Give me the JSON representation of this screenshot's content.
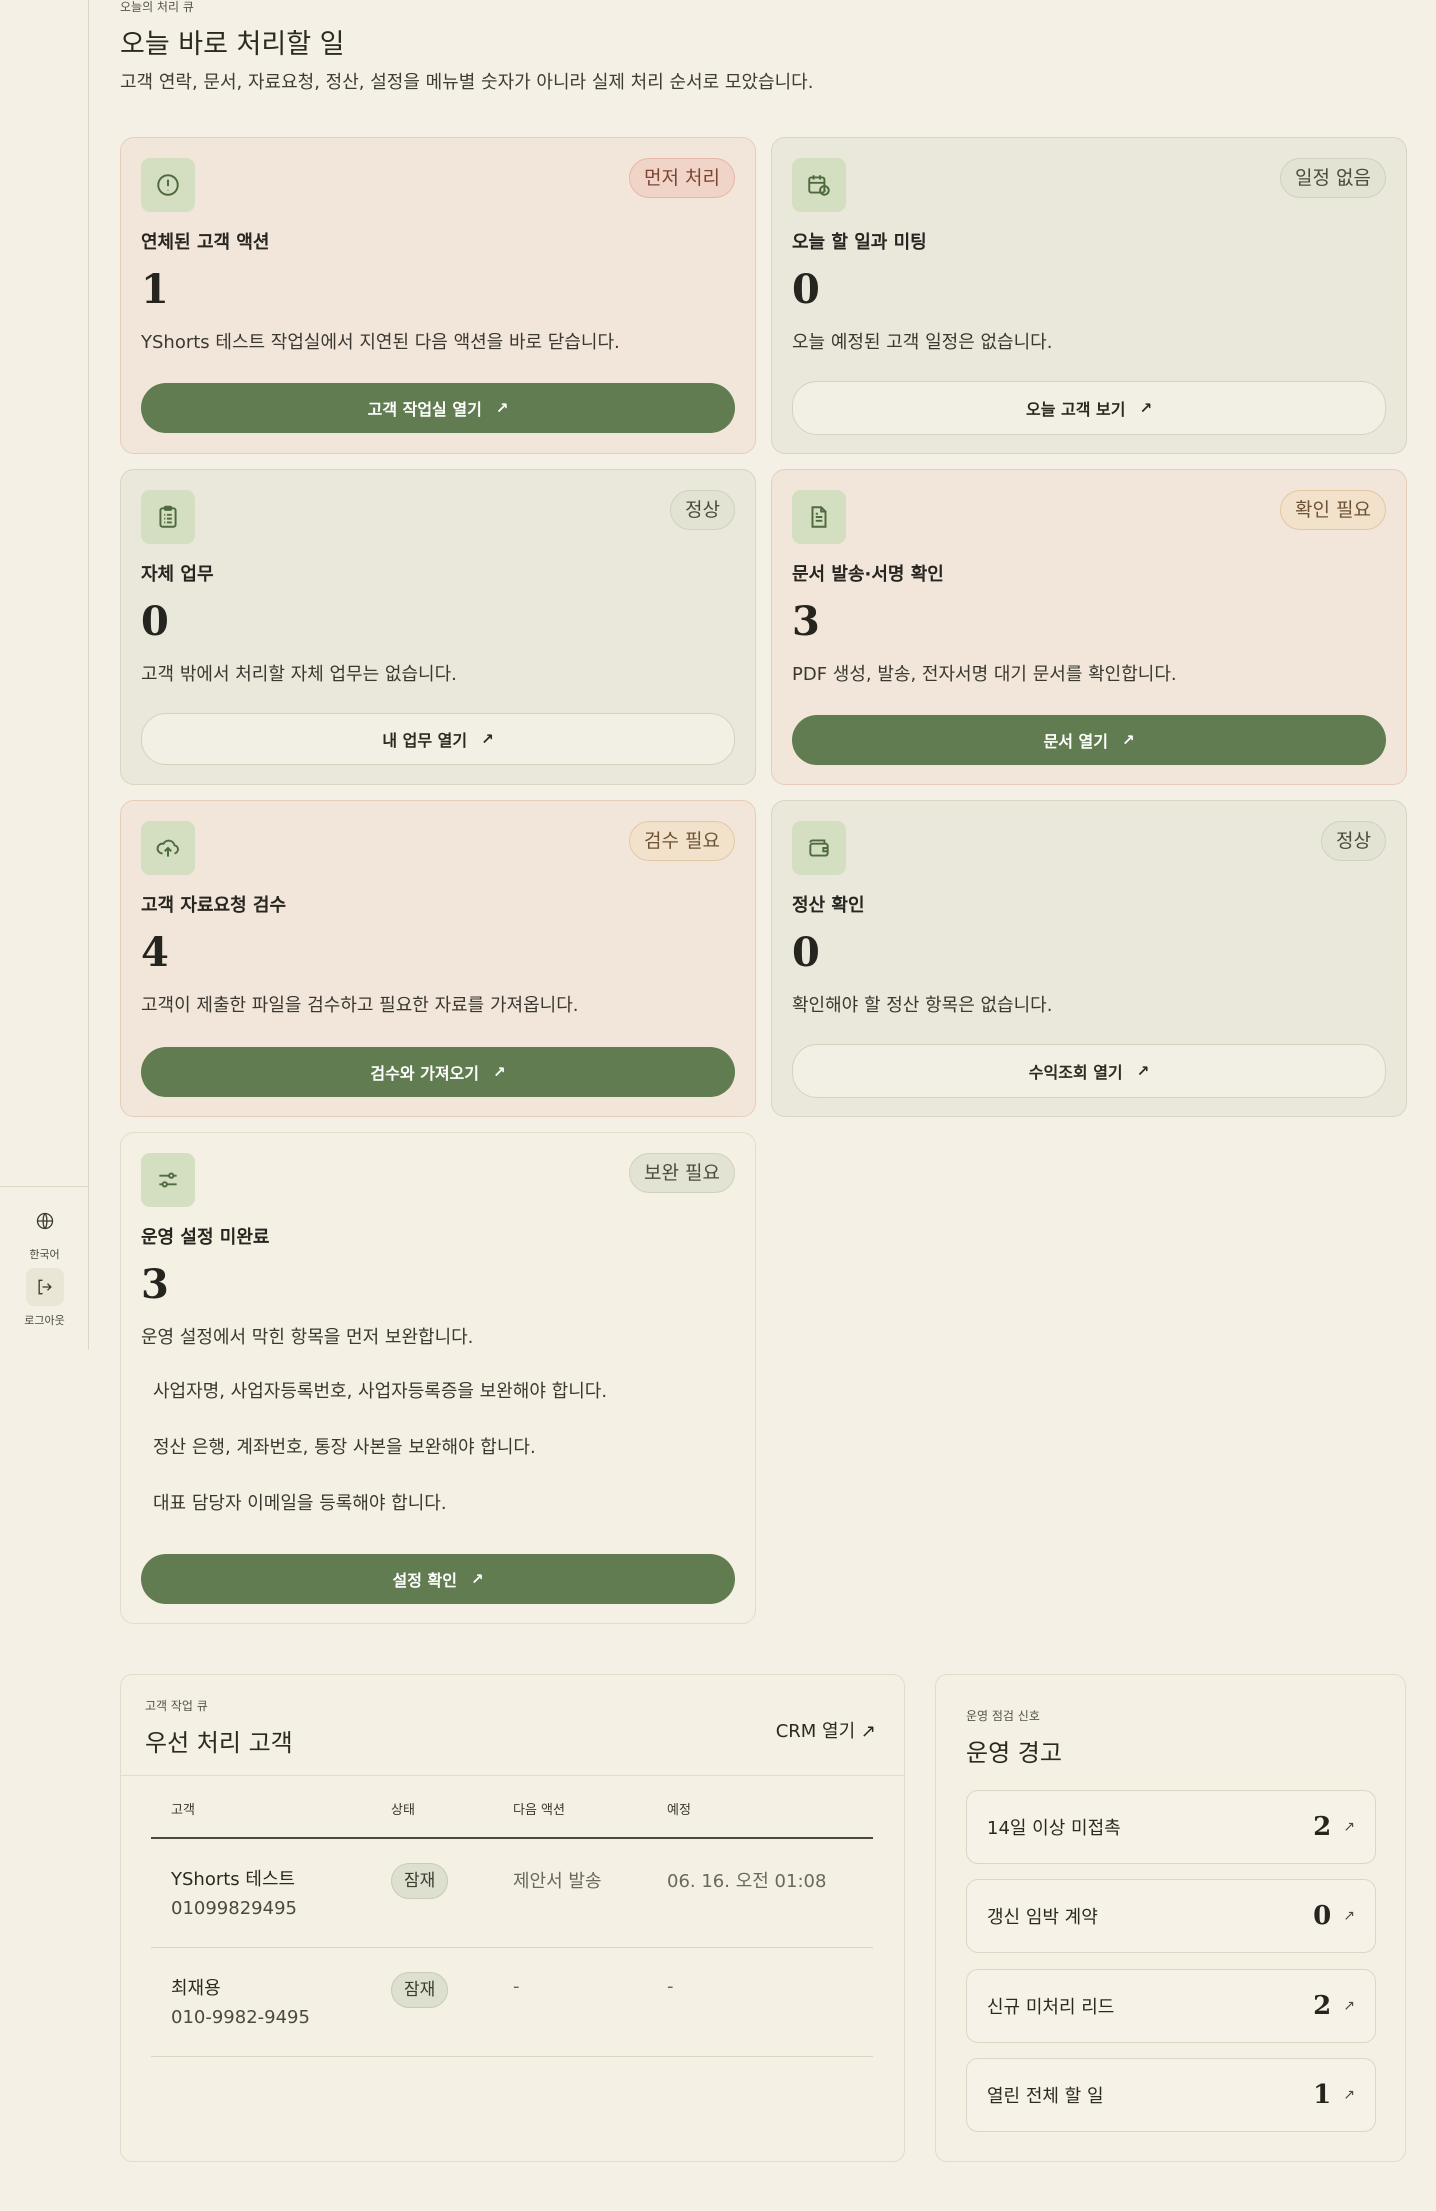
{
  "sidebar": {
    "language_label": "한국어",
    "logout_label": "로그아웃"
  },
  "header": {
    "eyebrow": "오늘의 처리 큐",
    "title": "오늘 바로 처리할 일",
    "subtitle": "고객 연락, 문서, 자료요청, 정산, 설정을 메뉴별 숫자가 아니라 실제 처리 순서로 모았습니다."
  },
  "cards": {
    "overdue": {
      "badge": "먼저 처리",
      "title": "연체된 고객 액션",
      "count": "1",
      "desc": "YShorts 테스트 작업실에서 지연된 다음 액션을 바로 닫습니다.",
      "button": "고객 작업실 열기",
      "icon": "alert-circle-icon"
    },
    "today": {
      "badge": "일정 없음",
      "title": "오늘 할 일과 미팅",
      "count": "0",
      "desc": "오늘 예정된 고객 일정은 없습니다.",
      "button": "오늘 고객 보기",
      "icon": "calendar-clock-icon"
    },
    "tasks": {
      "badge": "정상",
      "title": "자체 업무",
      "count": "0",
      "desc": "고객 밖에서 처리할 자체 업무는 없습니다.",
      "button": "내 업무 열기",
      "icon": "clipboard-list-icon"
    },
    "documents": {
      "badge": "확인 필요",
      "title": "문서 발송·서명 확인",
      "count": "3",
      "desc": "PDF 생성, 발송, 전자서명 대기 문서를 확인합니다.",
      "button": "문서 열기",
      "icon": "file-text-icon"
    },
    "requests": {
      "badge": "검수 필요",
      "title": "고객 자료요청 검수",
      "count": "4",
      "desc": "고객이 제출한 파일을 검수하고 필요한 자료를 가져옵니다.",
      "button": "검수와 가져오기",
      "icon": "cloud-upload-icon"
    },
    "settlement": {
      "badge": "정상",
      "title": "정산 확인",
      "count": "0",
      "desc": "확인해야 할 정산 항목은 없습니다.",
      "button": "수익조회 열기",
      "icon": "wallet-icon"
    },
    "settings": {
      "badge": "보완 필요",
      "title": "운영 설정 미완료",
      "count": "3",
      "desc": "운영 설정에서 막힌 항목을 먼저 보완합니다.",
      "issues": [
        "사업자명, 사업자등록번호, 사업자등록증을 보완해야 합니다.",
        "정산 은행, 계좌번호, 통장 사본을 보완해야 합니다.",
        "대표 담당자 이메일을 등록해야 합니다."
      ],
      "button": "설정 확인",
      "icon": "sliders-icon"
    }
  },
  "priority": {
    "eyebrow": "고객 작업 큐",
    "title": "우선 처리 고객",
    "crm_link": "CRM 열기",
    "columns": [
      "고객",
      "상태",
      "다음 액션",
      "예정"
    ],
    "rows": [
      {
        "name": "YShorts 테스트",
        "phone": "01099829495",
        "status": "잠재",
        "next_action": "제안서 발송",
        "due": "06. 16. 오전 01:08"
      },
      {
        "name": "최재용",
        "phone": "010-9982-9495",
        "status": "잠재",
        "next_action": "-",
        "due": "-"
      }
    ]
  },
  "alerts": {
    "eyebrow": "운영 점검 신호",
    "title": "운영 경고",
    "items": [
      {
        "label": "14일 이상 미접촉",
        "count": "2"
      },
      {
        "label": "갱신 임박 계약",
        "count": "0"
      },
      {
        "label": "신규 미처리 리드",
        "count": "2"
      },
      {
        "label": "열린 전체 할 일",
        "count": "1"
      }
    ]
  },
  "colors": {
    "background": "#f4f0e5",
    "accent_green": "#627c51",
    "warm_card": "#f2e6da",
    "neutral_card": "#eae7db"
  }
}
